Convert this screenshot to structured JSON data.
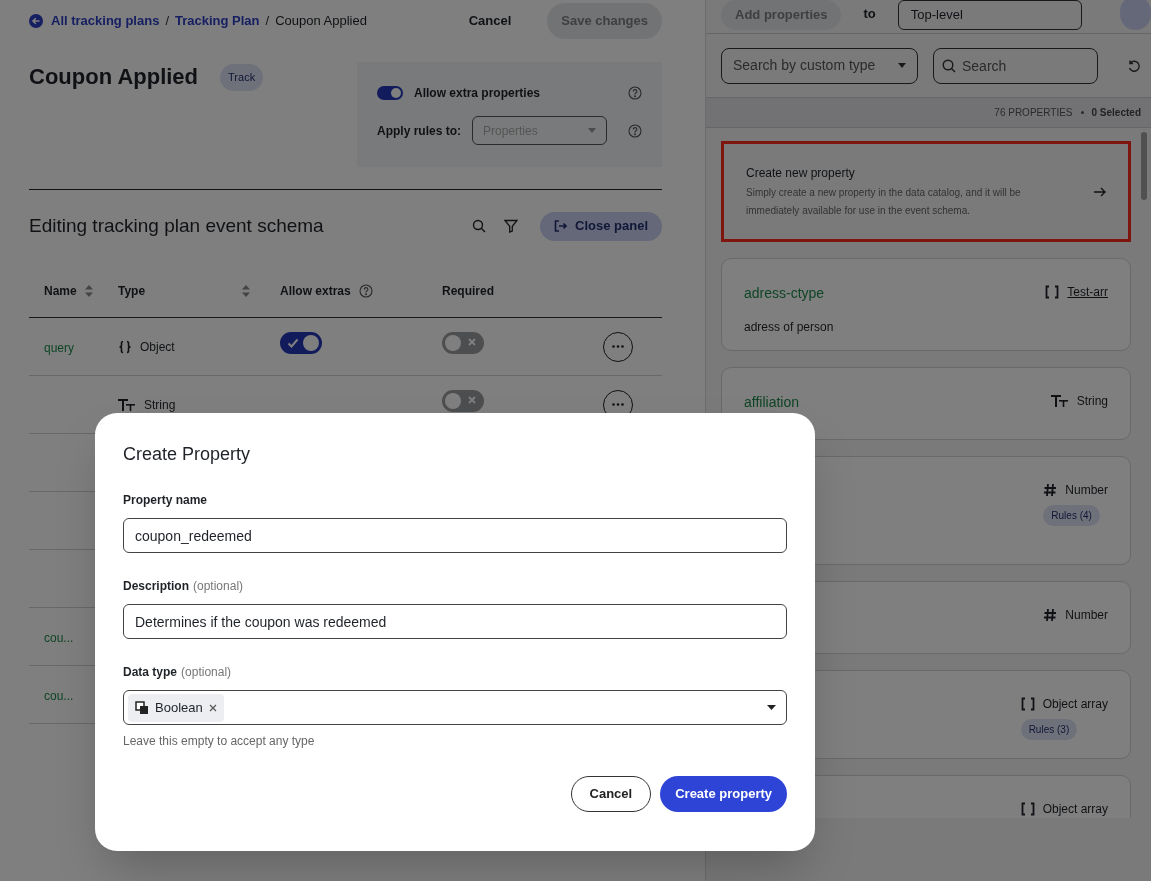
{
  "breadcrumb": [
    {
      "text": "All tracking plans",
      "kind": "link"
    },
    {
      "text": "/",
      "kind": "separator"
    },
    {
      "text": "Tracking Plan",
      "kind": "link"
    },
    {
      "text": "/",
      "kind": "separator"
    },
    {
      "text": "Coupon Applied",
      "kind": "current"
    }
  ],
  "header_buttons": {
    "cancel": "Cancel",
    "save": {
      "label": "Save changes",
      "disabled": true
    }
  },
  "event": {
    "name": "Coupon Applied",
    "badge": "Track"
  },
  "settings": {
    "allow_extra": {
      "label": "Allow extra properties",
      "on": true
    },
    "apply_rules": {
      "label": "Apply rules to:",
      "placeholder": "Properties"
    }
  },
  "schema": {
    "title": "Editing tracking plan event schema",
    "close_button": "Close panel",
    "columns": [
      {
        "label": "Name",
        "sortable": true
      },
      {
        "label": "Type",
        "sortable": true
      },
      {
        "label": "Allow extras",
        "help": true
      },
      {
        "label": "Required"
      }
    ],
    "rows": [
      {
        "name": "query",
        "type": "Object",
        "kind": "object",
        "allow_extras": true,
        "required": false
      },
      {
        "type": "String",
        "kind": "string",
        "required": false
      },
      {},
      {},
      {},
      {
        "name": "cou..."
      },
      {
        "name": "cou..."
      }
    ]
  },
  "right_panel": {
    "top": {
      "add_button": "Add properties",
      "to": "to",
      "level_select": "Top-level"
    },
    "custom_type_select": "Search by custom type",
    "search": {
      "placeholder": "Search"
    },
    "count": "76 PROPERTIES",
    "selected": "0 Selected",
    "create_card": {
      "title": "Create new property",
      "description": "Simply create a new property in the data catalog, and it will be immediately available for use in the event schema.",
      "highlighted": true
    },
    "cards": [
      {
        "name": "adress-ctype",
        "description": "adress of person",
        "type": "Test-arr",
        "kind": "array",
        "link": true
      },
      {
        "name": "affiliation",
        "type": "String",
        "kind": "string"
      },
      {
        "type": "Number",
        "kind": "number",
        "rules": "Rules (4)"
      },
      {
        "type": "Number",
        "kind": "number"
      },
      {
        "type": "Object array",
        "kind": "array",
        "rules": "Rules (3)"
      },
      {
        "type": "Object array",
        "kind": "array"
      }
    ]
  },
  "modal": {
    "title": "Create Property",
    "fields": [
      {
        "label": "Property name",
        "value": "coupon_redeemed"
      },
      {
        "label": "Description",
        "optional": "(optional)",
        "value": "Determines if the coupon was redeemed"
      }
    ],
    "data_type": {
      "label": "Data type",
      "optional": "(optional)",
      "chip": "Boolean",
      "hint": "Leave this empty to accept any type"
    },
    "buttons": [
      {
        "label": "Cancel",
        "primary": false
      },
      {
        "label": "Create property",
        "primary": true
      }
    ]
  }
}
